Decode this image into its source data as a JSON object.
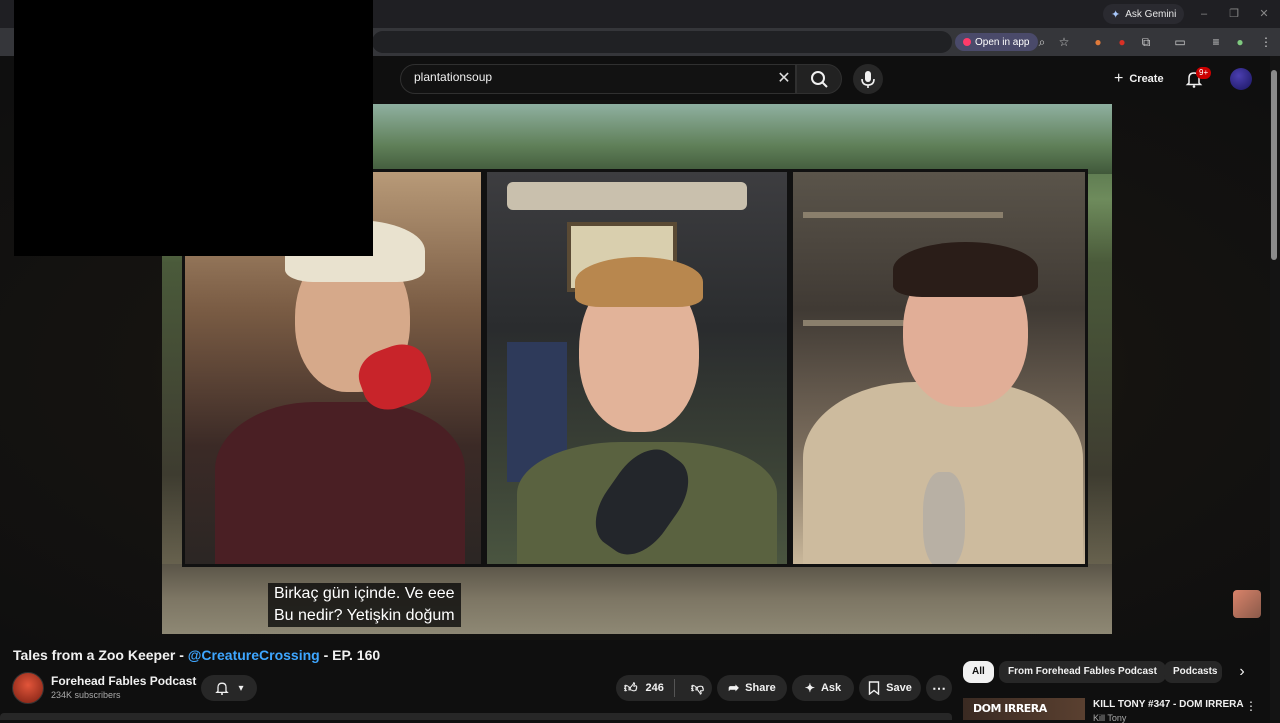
{
  "browser": {
    "ask_gemini": "Ask Gemini",
    "open_in_app": "Open in app"
  },
  "masthead": {
    "search_value": "plantationsoup",
    "create_label": "Create",
    "notifications_badge": "9+"
  },
  "video": {
    "subtitle_line1": "Birkaç gün içinde. Ve eee",
    "subtitle_line2": "Bu nedir? Yetişkin doğum"
  },
  "details": {
    "title_prefix": "Tales from a Zoo Keeper - ",
    "title_link": "@CreatureCrossing",
    "title_suffix": " - EP. 160",
    "channel_name": "Forehead Fables Podcast",
    "channel_subs": "234K subscribers",
    "like_count": "246",
    "share_label": "Share",
    "ask_label": "Ask",
    "save_label": "Save"
  },
  "chips": {
    "all": "All",
    "forehead": "From Forehead Fables Podcast",
    "podcasts": "Podcasts"
  },
  "recommendation": {
    "thumb_text": "DOM IRRERA",
    "title": "KILL TONY #347 - DOM IRRERA",
    "channel": "Kill Tony"
  },
  "colors": {
    "accent_link": "#3ea6ff",
    "notification_red": "#cc0000",
    "background": "#0f0f0f"
  }
}
